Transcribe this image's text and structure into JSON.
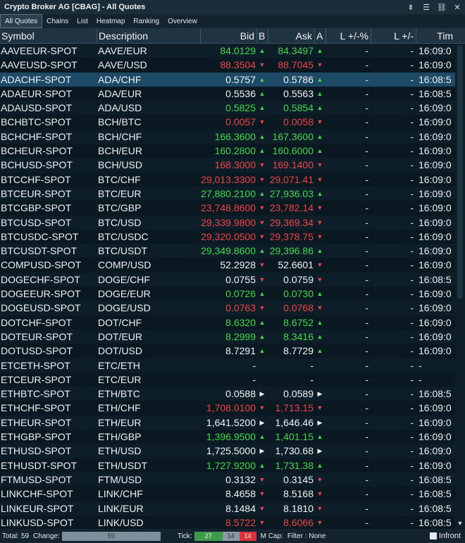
{
  "window": {
    "title": "Crypto Broker AG [CBAG] - All Quotes",
    "buttons": [
      {
        "name": "layout-icon",
        "glyph": "⇟"
      },
      {
        "name": "menu-icon",
        "glyph": "☰"
      },
      {
        "name": "link-icon",
        "glyph": "⛓"
      },
      {
        "name": "close-icon",
        "glyph": "✕"
      }
    ]
  },
  "tabs": [
    "All Quotes",
    "Chains",
    "List",
    "Heatmap",
    "Ranking",
    "Overview"
  ],
  "columns": {
    "symbol": "Symbol",
    "description": "Description",
    "bid": "Bid",
    "bid_flag": "B",
    "ask": "Ask",
    "ask_flag": "A",
    "last_pct": "L +/-%",
    "last_chg": "L +/-",
    "time": "Tim"
  },
  "flags": {
    "up": "▲",
    "down": "▼",
    "neutral": "▶"
  },
  "rows": [
    {
      "symbol": "AAVEEUR-SPOT",
      "desc": "AAVE/EUR",
      "bid": "84.0129",
      "bid_dir": "up",
      "ask": "84.3497",
      "ask_dir": "up",
      "lpct": "-",
      "lchg": "-",
      "time": "16:09:0"
    },
    {
      "symbol": "AAVEUSD-SPOT",
      "desc": "AAVE/USD",
      "bid": "88.3504",
      "bid_dir": "down",
      "ask": "88.7045",
      "ask_dir": "down",
      "lpct": "-",
      "lchg": "-",
      "time": "16:09:0"
    },
    {
      "symbol": "ADACHF-SPOT",
      "desc": "ADA/CHF",
      "bid": "0.5757",
      "bid_dir": "neutral",
      "bflag": "up",
      "ask": "0.5786",
      "ask_dir": "neutral",
      "aflag": "up",
      "lpct": "-",
      "lchg": "-",
      "time": "16:08:5",
      "selected": true
    },
    {
      "symbol": "ADAEUR-SPOT",
      "desc": "ADA/EUR",
      "bid": "0.5536",
      "bid_dir": "neutral",
      "bflag": "up",
      "ask": "0.5563",
      "ask_dir": "neutral",
      "aflag": "up",
      "lpct": "-",
      "lchg": "-",
      "time": "16:08:5"
    },
    {
      "symbol": "ADAUSD-SPOT",
      "desc": "ADA/USD",
      "bid": "0.5825",
      "bid_dir": "up",
      "ask": "0.5854",
      "ask_dir": "up",
      "lpct": "-",
      "lchg": "-",
      "time": "16:09:0"
    },
    {
      "symbol": "BCHBTC-SPOT",
      "desc": "BCH/BTC",
      "bid": "0.0057",
      "bid_dir": "down",
      "ask": "0.0058",
      "ask_dir": "down",
      "lpct": "-",
      "lchg": "-",
      "time": "16:09:0"
    },
    {
      "symbol": "BCHCHF-SPOT",
      "desc": "BCH/CHF",
      "bid": "166.3600",
      "bid_dir": "up",
      "ask": "167.3600",
      "ask_dir": "up",
      "lpct": "-",
      "lchg": "-",
      "time": "16:09:0"
    },
    {
      "symbol": "BCHEUR-SPOT",
      "desc": "BCH/EUR",
      "bid": "160.2800",
      "bid_dir": "up",
      "ask": "160.6000",
      "ask_dir": "up",
      "lpct": "-",
      "lchg": "-",
      "time": "16:09:0"
    },
    {
      "symbol": "BCHUSD-SPOT",
      "desc": "BCH/USD",
      "bid": "168.3000",
      "bid_dir": "down",
      "ask": "169.1400",
      "ask_dir": "down",
      "lpct": "-",
      "lchg": "-",
      "time": "16:09:0"
    },
    {
      "symbol": "BTCCHF-SPOT",
      "desc": "BTC/CHF",
      "bid": "29,013.3300",
      "bid_dir": "down",
      "ask": "29,071.41",
      "ask_dir": "down",
      "lpct": "-",
      "lchg": "-",
      "time": "16:09:0"
    },
    {
      "symbol": "BTCEUR-SPOT",
      "desc": "BTC/EUR",
      "bid": "27,880.2100",
      "bid_dir": "up",
      "ask": "27,936.03",
      "ask_dir": "up",
      "lpct": "-",
      "lchg": "-",
      "time": "16:09:0"
    },
    {
      "symbol": "BTCGBP-SPOT",
      "desc": "BTC/GBP",
      "bid": "23,748.8600",
      "bid_dir": "down",
      "ask": "23,782.14",
      "ask_dir": "down",
      "lpct": "-",
      "lchg": "-",
      "time": "16:09:0"
    },
    {
      "symbol": "BTCUSD-SPOT",
      "desc": "BTC/USD",
      "bid": "29,339.9800",
      "bid_dir": "down",
      "ask": "29,369.34",
      "ask_dir": "down",
      "lpct": "-",
      "lchg": "-",
      "time": "16:09:0"
    },
    {
      "symbol": "BTCUSDC-SPOT",
      "desc": "BTC/USDC",
      "bid": "29,320.0500",
      "bid_dir": "down",
      "ask": "29,378.75",
      "ask_dir": "down",
      "lpct": "-",
      "lchg": "-",
      "time": "16:09:0"
    },
    {
      "symbol": "BTCUSDT-SPOT",
      "desc": "BTC/USDT",
      "bid": "29,349.8600",
      "bid_dir": "up",
      "ask": "29,396.86",
      "ask_dir": "up",
      "lpct": "-",
      "lchg": "-",
      "time": "16:09:0"
    },
    {
      "symbol": "COMPUSD-SPOT",
      "desc": "COMP/USD",
      "bid": "52.2928",
      "bid_dir": "neutral",
      "bflag": "down",
      "ask": "52.6601",
      "ask_dir": "neutral",
      "aflag": "down",
      "lpct": "-",
      "lchg": "-",
      "time": "16:09:0"
    },
    {
      "symbol": "DOGECHF-SPOT",
      "desc": "DOGE/CHF",
      "bid": "0.0755",
      "bid_dir": "neutral",
      "bflag": "down",
      "ask": "0.0759",
      "ask_dir": "neutral",
      "aflag": "down",
      "lpct": "-",
      "lchg": "-",
      "time": "16:08:5"
    },
    {
      "symbol": "DOGEEUR-SPOT",
      "desc": "DOGE/EUR",
      "bid": "0.0726",
      "bid_dir": "up",
      "ask": "0.0730",
      "ask_dir": "up",
      "lpct": "-",
      "lchg": "-",
      "time": "16:09:0"
    },
    {
      "symbol": "DOGEUSD-SPOT",
      "desc": "DOGE/USD",
      "bid": "0.0763",
      "bid_dir": "down",
      "ask": "0.0768",
      "ask_dir": "down",
      "lpct": "-",
      "lchg": "-",
      "time": "16:09:0"
    },
    {
      "symbol": "DOTCHF-SPOT",
      "desc": "DOT/CHF",
      "bid": "8.6320",
      "bid_dir": "up",
      "ask": "8.6752",
      "ask_dir": "up",
      "lpct": "-",
      "lchg": "-",
      "time": "16:09:0"
    },
    {
      "symbol": "DOTEUR-SPOT",
      "desc": "DOT/EUR",
      "bid": "8.2999",
      "bid_dir": "up",
      "ask": "8.3416",
      "ask_dir": "up",
      "lpct": "-",
      "lchg": "-",
      "time": "16:09:0"
    },
    {
      "symbol": "DOTUSD-SPOT",
      "desc": "DOT/USD",
      "bid": "8.7291",
      "bid_dir": "neutral",
      "bflag": "up",
      "ask": "8.7729",
      "ask_dir": "neutral",
      "aflag": "up",
      "lpct": "-",
      "lchg": "-",
      "time": "16:09:0"
    },
    {
      "symbol": "ETCETH-SPOT",
      "desc": "ETC/ETH",
      "bid": "-",
      "bid_dir": "neutral",
      "ask": "-",
      "ask_dir": "neutral",
      "lpct": "-",
      "lchg": "-",
      "time": "-"
    },
    {
      "symbol": "ETCEUR-SPOT",
      "desc": "ETC/EUR",
      "bid": "-",
      "bid_dir": "neutral",
      "ask": "-",
      "ask_dir": "neutral",
      "lpct": "-",
      "lchg": "-",
      "time": "-"
    },
    {
      "symbol": "ETHBTC-SPOT",
      "desc": "ETH/BTC",
      "bid": "0.0588",
      "bid_dir": "neutral",
      "bflag": "neutral",
      "ask": "0.0589",
      "ask_dir": "neutral",
      "aflag": "neutral",
      "lpct": "-",
      "lchg": "-",
      "time": "16:08:5"
    },
    {
      "symbol": "ETHCHF-SPOT",
      "desc": "ETH/CHF",
      "bid": "1,708.0100",
      "bid_dir": "down",
      "ask": "1,713.15",
      "ask_dir": "down",
      "lpct": "-",
      "lchg": "-",
      "time": "16:09:0"
    },
    {
      "symbol": "ETHEUR-SPOT",
      "desc": "ETH/EUR",
      "bid": "1,641.5200",
      "bid_dir": "neutral",
      "bflag": "neutral",
      "ask": "1,646.46",
      "ask_dir": "neutral",
      "aflag": "neutral",
      "lpct": "-",
      "lchg": "-",
      "time": "16:09:0"
    },
    {
      "symbol": "ETHGBP-SPOT",
      "desc": "ETH/GBP",
      "bid": "1,396.9500",
      "bid_dir": "up",
      "ask": "1,401.15",
      "ask_dir": "up",
      "lpct": "-",
      "lchg": "-",
      "time": "16:09:0"
    },
    {
      "symbol": "ETHUSD-SPOT",
      "desc": "ETH/USD",
      "bid": "1,725.5000",
      "bid_dir": "neutral",
      "bflag": "neutral",
      "ask": "1,730.68",
      "ask_dir": "neutral",
      "aflag": "neutral",
      "lpct": "-",
      "lchg": "-",
      "time": "16:09:0"
    },
    {
      "symbol": "ETHUSDT-SPOT",
      "desc": "ETH/USDT",
      "bid": "1,727.9200",
      "bid_dir": "up",
      "ask": "1,731.38",
      "ask_dir": "up",
      "lpct": "-",
      "lchg": "-",
      "time": "16:09:0"
    },
    {
      "symbol": "FTMUSD-SPOT",
      "desc": "FTM/USD",
      "bid": "0.3132",
      "bid_dir": "neutral",
      "bflag": "down",
      "ask": "0.3145",
      "ask_dir": "neutral",
      "aflag": "down",
      "lpct": "-",
      "lchg": "-",
      "time": "16:08:5"
    },
    {
      "symbol": "LINKCHF-SPOT",
      "desc": "LINK/CHF",
      "bid": "8.4658",
      "bid_dir": "neutral",
      "bflag": "down",
      "ask": "8.5168",
      "ask_dir": "neutral",
      "aflag": "down",
      "lpct": "-",
      "lchg": "-",
      "time": "16:08:5"
    },
    {
      "symbol": "LINKEUR-SPOT",
      "desc": "LINK/EUR",
      "bid": "8.1484",
      "bid_dir": "neutral",
      "bflag": "down",
      "ask": "8.1810",
      "ask_dir": "neutral",
      "aflag": "down",
      "lpct": "-",
      "lchg": "-",
      "time": "16:08:5"
    },
    {
      "symbol": "LINKUSD-SPOT",
      "desc": "LINK/USD",
      "bid": "8.5722",
      "bid_dir": "down",
      "ask": "8.6066",
      "ask_dir": "down",
      "lpct": "-",
      "lchg": "-",
      "time": "16:08:5"
    }
  ],
  "status": {
    "total_label": "Total:",
    "total_value": "59",
    "change_label": "Change:",
    "change_value": "59",
    "tick_label": "Tick:",
    "tick_up": "27",
    "tick_flat": "14",
    "tick_down": "14",
    "mcap_label": "M Cap:",
    "filter_text": "Filter : None",
    "brand": "Infront"
  },
  "colors": {
    "up": "#41d84b",
    "down": "#ee4444",
    "selected": "#1d4a66"
  }
}
